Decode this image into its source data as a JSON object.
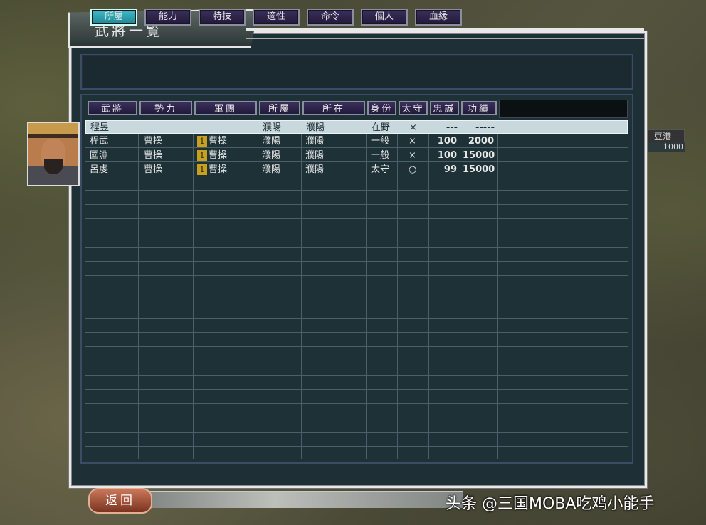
{
  "window": {
    "title": "武將一覧"
  },
  "map": {
    "label": "豆港",
    "value": "1000"
  },
  "tabs": [
    {
      "label": "所屬",
      "active": true
    },
    {
      "label": "能力",
      "active": false
    },
    {
      "label": "特技",
      "active": false
    },
    {
      "label": "適性",
      "active": false
    },
    {
      "label": "命令",
      "active": false
    },
    {
      "label": "個人",
      "active": false
    },
    {
      "label": "血縁",
      "active": false
    }
  ],
  "columns": [
    "武將",
    "勢力",
    "軍團",
    "所屬",
    "所在",
    "身份",
    "太守",
    "忠誠",
    "功績"
  ],
  "rows": [
    {
      "name": "程昱",
      "faction": "",
      "corps_num": "",
      "corps": "",
      "affil": "濮陽",
      "location": "濮陽",
      "status": "在野",
      "governor": "×",
      "loyalty": "---",
      "merit": "-----",
      "selected": true
    },
    {
      "name": "程武",
      "faction": "曹操",
      "corps_num": "1",
      "corps": "曹操",
      "affil": "濮陽",
      "location": "濮陽",
      "status": "一般",
      "governor": "×",
      "loyalty": "100",
      "merit": "2000",
      "selected": false
    },
    {
      "name": "國淵",
      "faction": "曹操",
      "corps_num": "1",
      "corps": "曹操",
      "affil": "濮陽",
      "location": "濮陽",
      "status": "一般",
      "governor": "×",
      "loyalty": "100",
      "merit": "15000",
      "selected": false
    },
    {
      "name": "呂虔",
      "faction": "曹操",
      "corps_num": "1",
      "corps": "曹操",
      "affil": "濮陽",
      "location": "濮陽",
      "status": "太守",
      "governor": "○",
      "loyalty": "99",
      "merit": "15000",
      "selected": false
    }
  ],
  "footer": {
    "back_label": "返回"
  },
  "watermark": "头条 @三国MOBA吃鸡小能手"
}
